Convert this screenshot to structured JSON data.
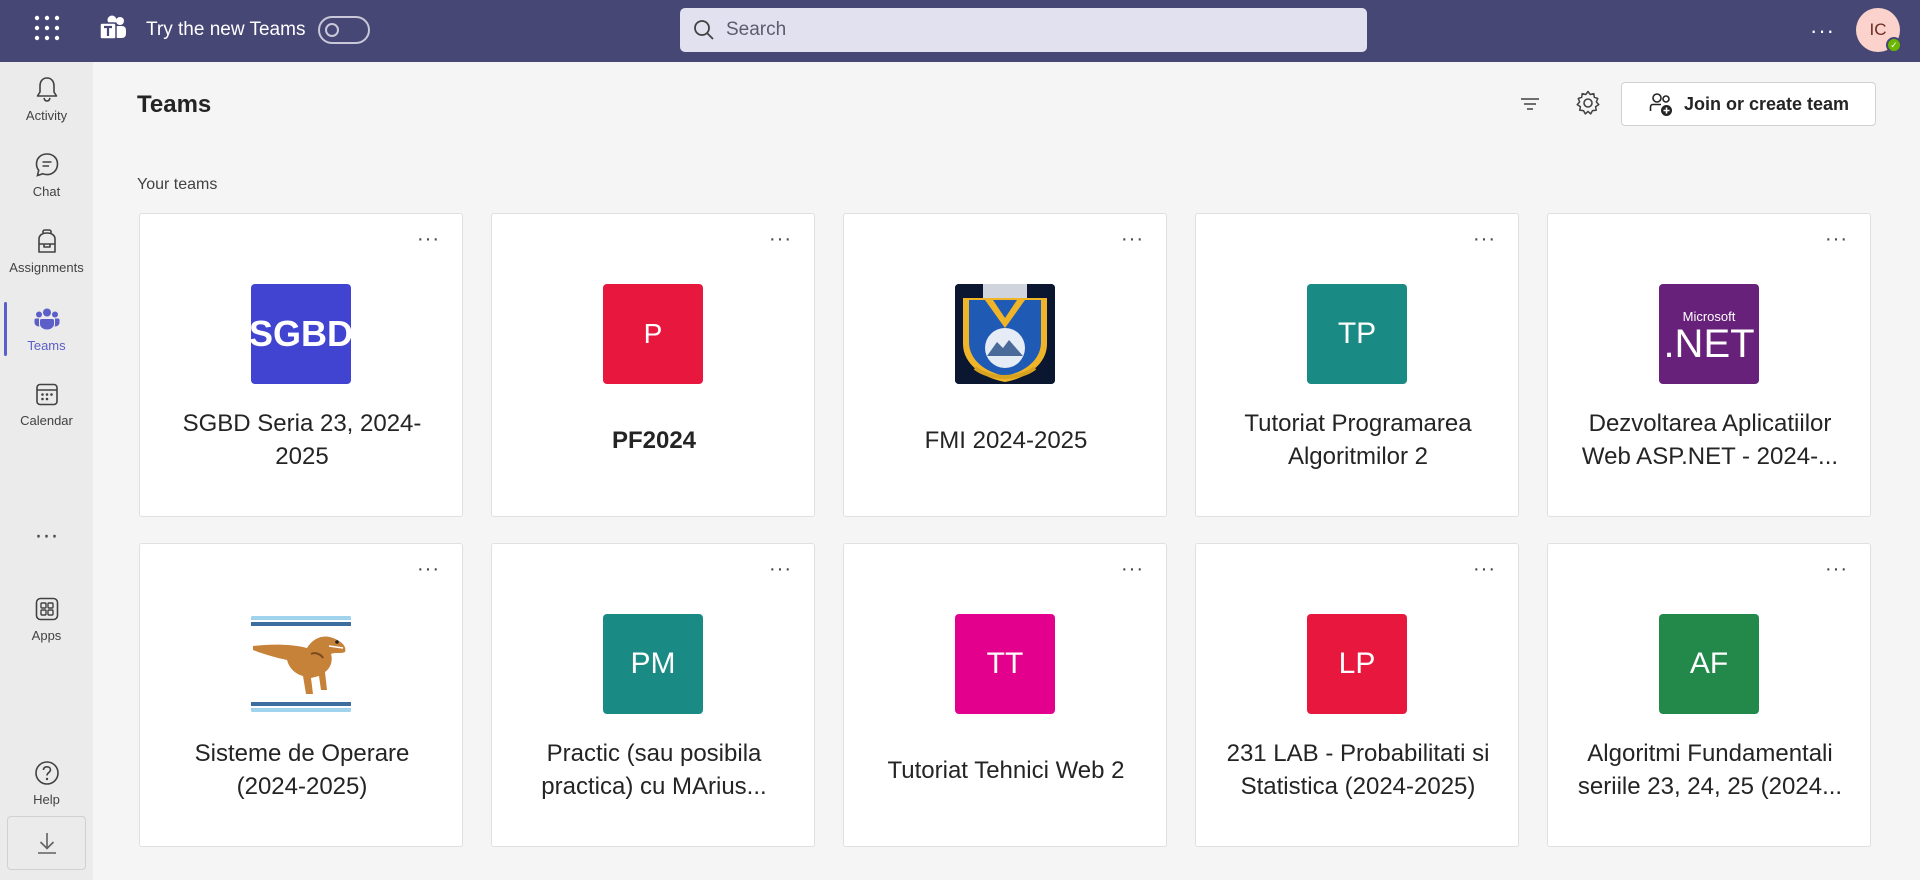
{
  "topbar": {
    "try_label": "Try the new Teams",
    "search_placeholder": "Search",
    "avatar_initials": "IC",
    "icons": {
      "apps": "waffle-icon",
      "teams_logo": "teams-logo-icon",
      "search": "search-icon",
      "more": "more-horizontal-icon"
    }
  },
  "rail": {
    "items": [
      {
        "label": "Activity",
        "icon": "bell-icon"
      },
      {
        "label": "Chat",
        "icon": "chat-icon"
      },
      {
        "label": "Assignments",
        "icon": "backpack-icon"
      },
      {
        "label": "Teams",
        "icon": "people-icon",
        "active": true
      },
      {
        "label": "Calendar",
        "icon": "calendar-icon"
      },
      {
        "label": "Apps",
        "icon": "apps-grid-icon"
      },
      {
        "label": "Help",
        "icon": "help-icon"
      }
    ],
    "more": "···",
    "download_icon": "download-icon"
  },
  "main": {
    "title": "Teams",
    "join_button": "Join or create team",
    "section_label": "Your teams",
    "card_more": "···",
    "teams": [
      {
        "name": "SGBD Seria 23, 2024-2025",
        "tile_text": "SGBD",
        "tile_color": "#4143d1",
        "bold": false
      },
      {
        "name": "PF2024",
        "tile_text": "P",
        "tile_color": "#e8173e",
        "bold": true
      },
      {
        "name": "FMI 2024-2025",
        "tile_text": "",
        "tile_color": "#0d1b3e",
        "tile_image": "university-crest",
        "bold": false
      },
      {
        "name": "Tutoriat Programarea Algoritmilor 2",
        "tile_text": "TP",
        "tile_color": "#1a8a85",
        "bold": false
      },
      {
        "name": "Dezvoltarea Aplicatiilor Web ASP.NET - 2024-...",
        "tile_text": ".NET",
        "tile_sub": "Microsoft",
        "tile_color": "#68217a",
        "bold": false
      },
      {
        "name": "Sisteme de Operare (2024-2025)",
        "tile_text": "",
        "tile_color": "#ffffff",
        "tile_image": "dinosaur-illustration",
        "bold": false
      },
      {
        "name": "Practic (sau posibila practica) cu MArius...",
        "tile_text": "PM",
        "tile_color": "#1a8a85",
        "bold": false
      },
      {
        "name": "Tutoriat Tehnici Web 2",
        "tile_text": "TT",
        "tile_color": "#e3008c",
        "bold": false
      },
      {
        "name": "231 LAB - Probabilitati si Statistica (2024-2025)",
        "tile_text": "LP",
        "tile_color": "#e8173e",
        "bold": false
      },
      {
        "name": "Algoritmi Fundamentali seriile 23, 24, 25 (2024...",
        "tile_text": "AF",
        "tile_color": "#23894a",
        "bold": false
      }
    ]
  }
}
